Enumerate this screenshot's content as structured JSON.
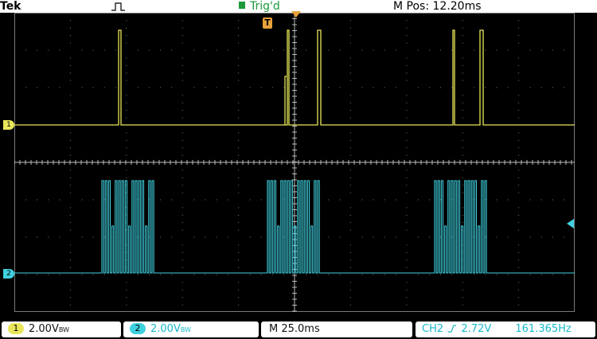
{
  "header": {
    "brand": "Tek",
    "acquisition_icon": "pulse-run-icon",
    "trigger_status": "Trig'd",
    "horizontal_position": "M Pos: 12.20ms"
  },
  "markers": {
    "trigger_marker": "T",
    "ch1_marker": "1",
    "ch2_marker": "2"
  },
  "readouts": {
    "ch1_number": "1",
    "ch1_scale": "2.00V",
    "ch1_bw_suffix": "BW",
    "ch2_number": "2",
    "ch2_scale": "2.00V",
    "ch2_bw_suffix": "BW",
    "timebase": "M 25.0ms",
    "trigger_source": "CH2",
    "trigger_level": "2.72V",
    "frequency": "161.365Hz"
  },
  "colors": {
    "ch1": "#e8e65a",
    "ch2": "#3fd1e0",
    "trigger_marker": "#e9a23b",
    "grid": "#7a7a7a",
    "screen_bg": "#000000"
  }
}
